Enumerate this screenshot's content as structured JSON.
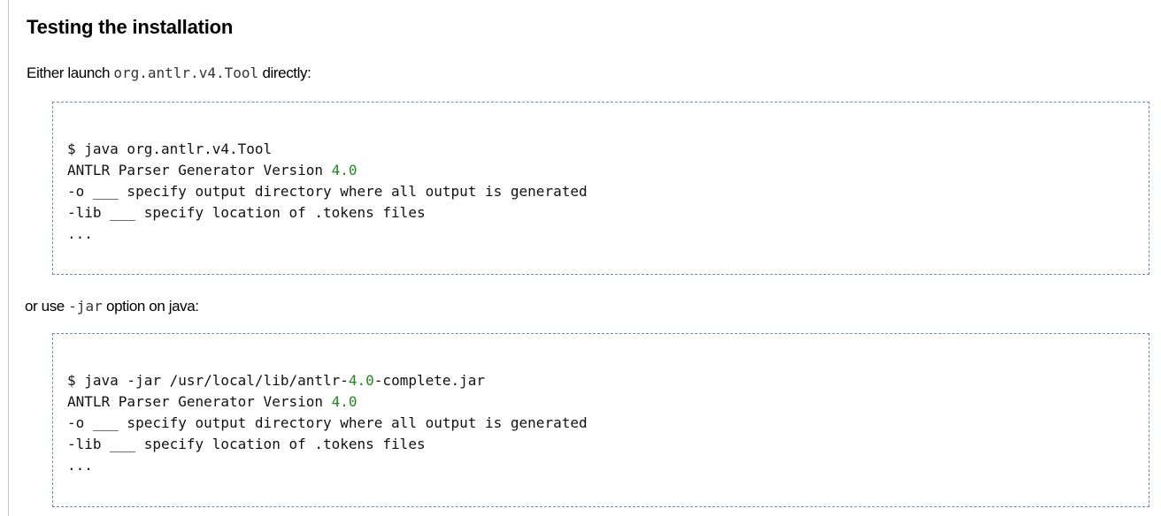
{
  "heading": "Testing the installation",
  "intro": {
    "before": "Either launch ",
    "code": "org.antlr.v4.Tool",
    "after": " directly:"
  },
  "block1": [
    {
      "pre": "$ java org.antlr.v4.Tool",
      "num": "",
      "post": ""
    },
    {
      "pre": "ANTLR Parser Generator Version ",
      "num": "4.0",
      "post": ""
    },
    {
      "pre": "-o ___ specify output directory where all output is generated",
      "num": "",
      "post": ""
    },
    {
      "pre": "-lib ___ specify location of .tokens files",
      "num": "",
      "post": ""
    },
    {
      "pre": "...",
      "num": "",
      "post": ""
    }
  ],
  "second": {
    "before": "or use ",
    "code": "-jar",
    "after": " option on java:"
  },
  "block2": [
    {
      "pre": "$ java -jar /usr/local/lib/antlr-",
      "num": "4.0",
      "post": "-complete.jar"
    },
    {
      "pre": "ANTLR Parser Generator Version ",
      "num": "4.0",
      "post": ""
    },
    {
      "pre": "-o ___ specify output directory where all output is generated",
      "num": "",
      "post": ""
    },
    {
      "pre": "-lib ___ specify location of .tokens files",
      "num": "",
      "post": ""
    },
    {
      "pre": "...",
      "num": "",
      "post": ""
    }
  ],
  "colors": {
    "number": "#1e8a1e",
    "box_border": "#6b8cba"
  }
}
